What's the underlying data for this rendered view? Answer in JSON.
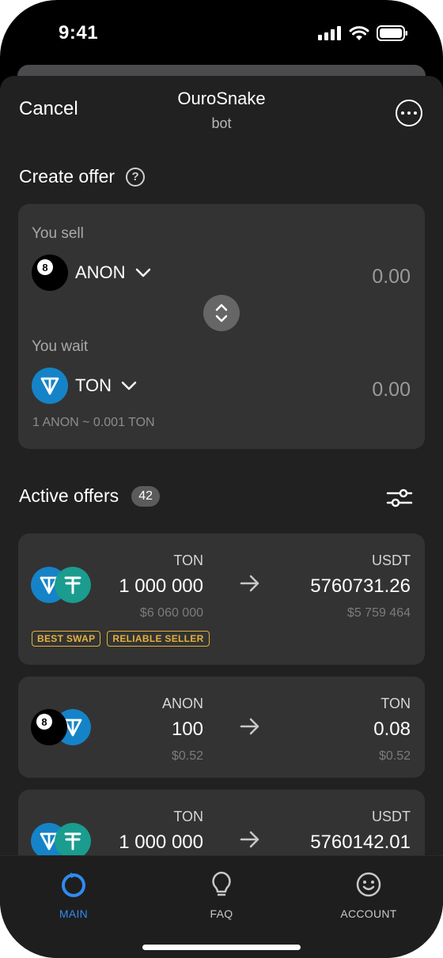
{
  "status": {
    "time": "9:41"
  },
  "header": {
    "cancel": "Cancel",
    "title": "OuroSnake",
    "subtitle": "bot"
  },
  "create_offer": {
    "title": "Create offer",
    "help": "?",
    "sell_label": "You sell",
    "sell_token": "ANON",
    "sell_amount": "0.00",
    "wait_label": "You wait",
    "wait_token": "TON",
    "wait_amount": "0.00",
    "rate": "1 ANON ~ 0.001 TON"
  },
  "active_offers": {
    "title": "Active offers",
    "count": "42",
    "items": [
      {
        "from_symbol": "TON",
        "from_amount": "1 000 000",
        "from_usd": "$6 060 000",
        "to_symbol": "USDT",
        "to_amount": "5760731.26",
        "to_usd": "$5 759 464",
        "tags": [
          "BEST SWAP",
          "RELIABLE SELLER"
        ]
      },
      {
        "from_symbol": "ANON",
        "from_amount": "100",
        "from_usd": "$0.52",
        "to_symbol": "TON",
        "to_amount": "0.08",
        "to_usd": "$0.52"
      },
      {
        "from_symbol": "TON",
        "from_amount": "1 000 000",
        "to_symbol": "USDT",
        "to_amount": "5760142.01"
      }
    ]
  },
  "tabs": [
    {
      "label": "MAIN",
      "icon": "main-ring-icon",
      "active": true
    },
    {
      "label": "FAQ",
      "icon": "lightbulb-icon",
      "active": false
    },
    {
      "label": "ACCOUNT",
      "icon": "smile-icon",
      "active": false
    }
  ],
  "colors": {
    "background": "#212121",
    "card": "#333333",
    "accent": "#2f8bf0",
    "tag": "#e2b23c",
    "ton_blue": "#1583c7",
    "usdt_teal": "#1a9c8e"
  }
}
